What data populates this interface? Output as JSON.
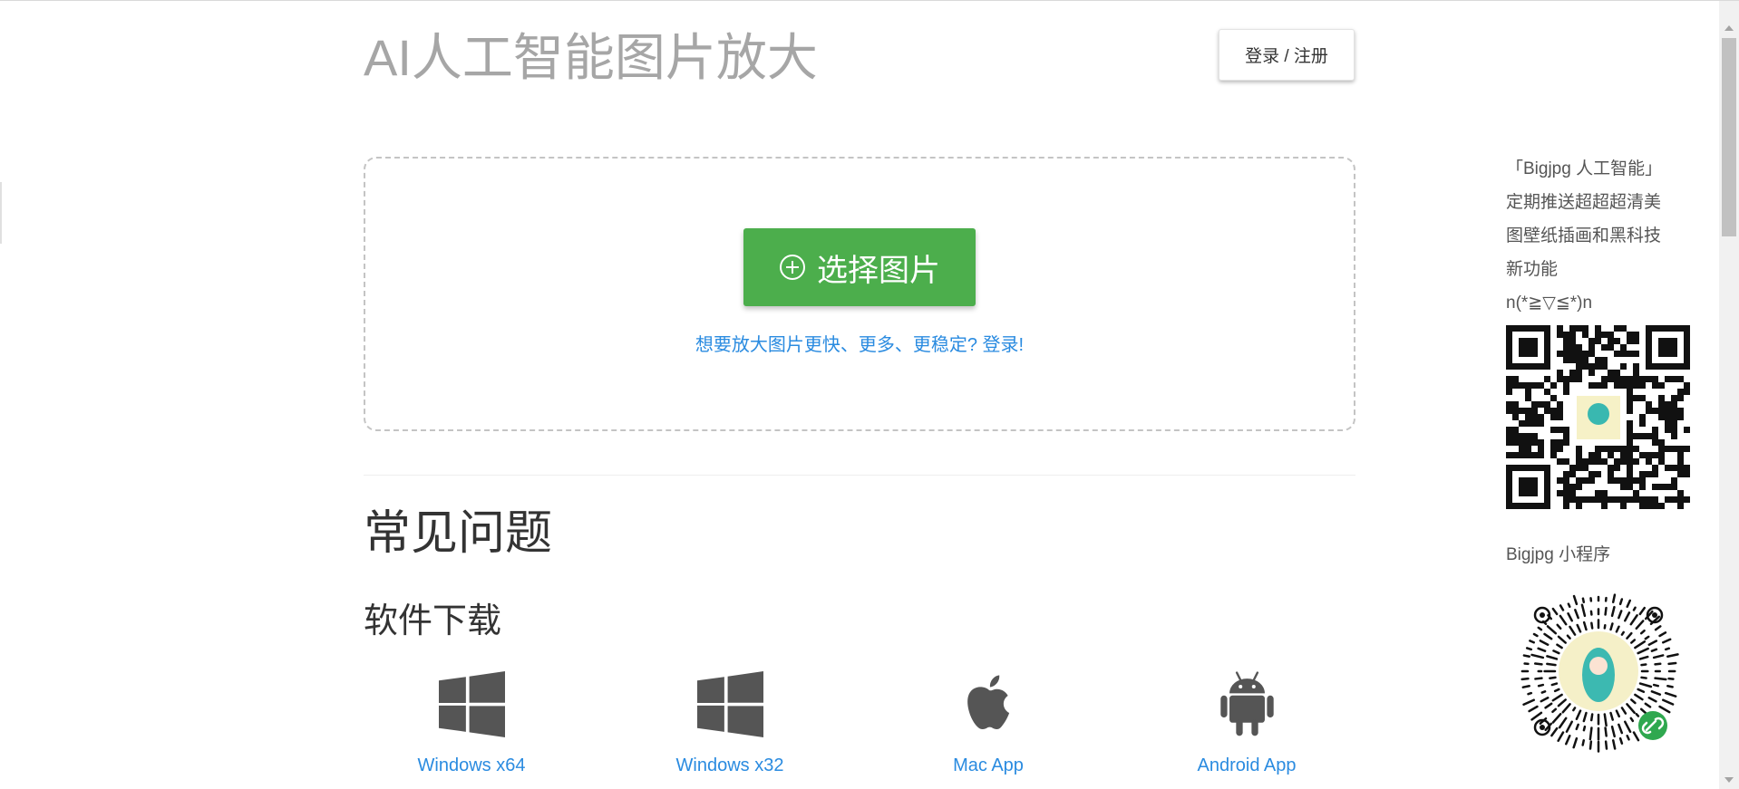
{
  "header": {
    "title": "AI人工智能图片放大",
    "login_label": "登录 / 注册"
  },
  "upload": {
    "choose_label": "选择图片",
    "upgrade_link": "想要放大图片更快、更多、更稳定? 登录!"
  },
  "faq": {
    "title": "常见问题",
    "download_title": "软件下载",
    "downloads": [
      {
        "label": "Windows x64",
        "icon": "windows-icon"
      },
      {
        "label": "Windows x32",
        "icon": "windows-icon"
      },
      {
        "label": "Mac App",
        "icon": "apple-icon"
      },
      {
        "label": "Android App",
        "icon": "android-icon"
      }
    ]
  },
  "sidebar": {
    "promo_lines": [
      "「Bigjpg 人工智能」",
      "定期推送超超超清美",
      "图壁纸插画和黑科技",
      "新功能",
      "n(*≧▽≦*)n"
    ],
    "mini_program_label": "Bigjpg 小程序"
  },
  "colors": {
    "accent_green": "#4cae4c",
    "link_blue": "#2a8be0",
    "title_gray": "#a6a6a6"
  }
}
